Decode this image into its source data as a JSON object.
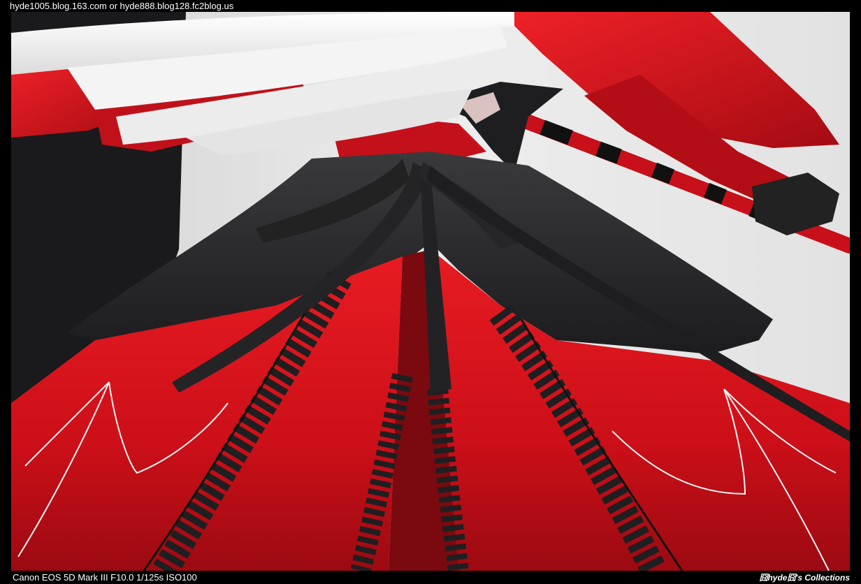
{
  "header": {
    "source_text": "hyde1005.blog.163.com or hyde888.blog128.fc2blog.us"
  },
  "footer": {
    "exif_text": "Canon EOS 5D Mark III F10.0 1/125s ISO100",
    "brand_text": "囧hyde囧's Collections"
  },
  "colors": {
    "frame": "#000000",
    "background": "#e9e9e9",
    "red": "#d4101a",
    "red_dark": "#8e0a10",
    "black_fabric": "#2a2a2c",
    "white_hair": "#f2f2f2"
  }
}
